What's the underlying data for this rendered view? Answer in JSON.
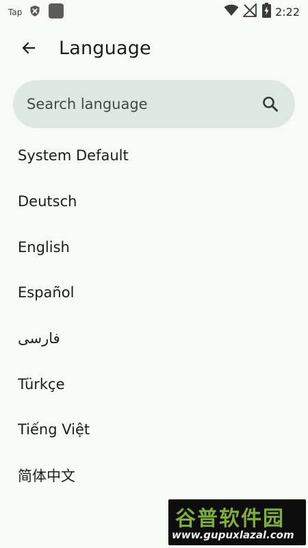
{
  "status_bar": {
    "app_label": "Tap",
    "clock": "2:22",
    "icons": [
      "shield-x-icon",
      "app-square-icon",
      "wifi-icon",
      "no-signal-icon",
      "battery-charging-icon"
    ]
  },
  "header": {
    "back_icon": "arrow-back-icon",
    "title": "Language"
  },
  "search": {
    "placeholder": "Search language",
    "value": "",
    "icon": "search-icon"
  },
  "languages": [
    {
      "label": "System Default"
    },
    {
      "label": "Deutsch"
    },
    {
      "label": "English"
    },
    {
      "label": "Español"
    },
    {
      "label": "فارسی"
    },
    {
      "label": "Türkçe"
    },
    {
      "label": "Tiếng Việt"
    },
    {
      "label": "简体中文"
    }
  ],
  "watermark": {
    "brand": "谷普软件园",
    "url": "www.gupuxlazal.com"
  },
  "colors": {
    "background": "#f8faf5",
    "search_fill": "#dde8e0",
    "text": "#1b1d1a"
  }
}
